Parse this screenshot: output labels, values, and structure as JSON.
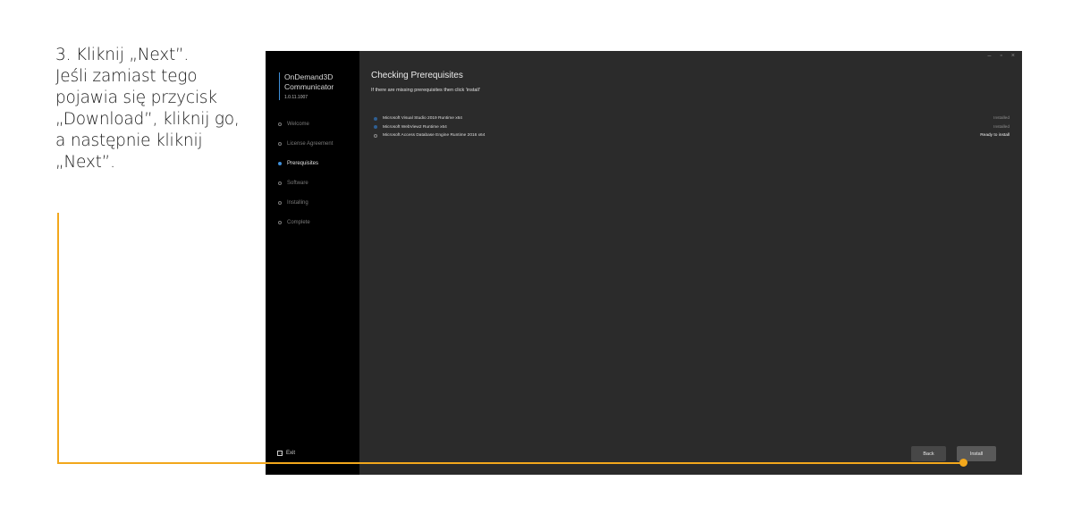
{
  "instruction": {
    "lines": [
      "3. Kliknij „Next”.",
      "Jeśli zamiast tego",
      "pojawia się przycisk",
      "„Download”, kliknij go,",
      "a następnie kliknij",
      "„Next”."
    ]
  },
  "app": {
    "name_line1": "OnDemand3D",
    "name_line2": "Communicator",
    "version": "1.0.11.1007"
  },
  "nav": {
    "items": [
      {
        "label": "Welcome",
        "active": false
      },
      {
        "label": "License Agreement",
        "active": false
      },
      {
        "label": "Prerequisites",
        "active": true
      },
      {
        "label": "Software",
        "active": false
      },
      {
        "label": "Installing",
        "active": false
      },
      {
        "label": "Complete",
        "active": false
      }
    ],
    "exit_label": "Exit"
  },
  "window_controls": {
    "minimize": "–",
    "restore": "▫",
    "close": "×"
  },
  "main": {
    "title": "Checking Prerequisites",
    "subtitle": "If there are missing prerequisites then click 'install'",
    "prerequisites": [
      {
        "name": "Microsoft Visual Studio 2019 Runtime x64",
        "status": "Installed"
      },
      {
        "name": "Microsoft WebView2 Runtime x64",
        "status": "Installed"
      },
      {
        "name": "Microsoft Access Database Engine Runtime 2016 x64",
        "status": "Ready to install"
      }
    ]
  },
  "buttons": {
    "back": "Back",
    "install": "Install"
  },
  "colors": {
    "accent": "#3f8fd9",
    "callout": "#f2a71c"
  }
}
